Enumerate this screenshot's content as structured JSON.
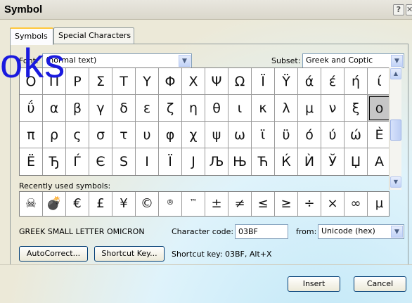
{
  "window": {
    "title": "Symbol"
  },
  "titlebar_buttons": {
    "help": "?",
    "close": "✕"
  },
  "tabs": [
    {
      "label": "Symbols",
      "active": true
    },
    {
      "label": "Special Characters",
      "active": false
    }
  ],
  "font": {
    "label": "Font:",
    "value": "(normal text)"
  },
  "subset": {
    "label": "Subset:",
    "value": "Greek and Coptic"
  },
  "symbols": [
    [
      "Ο",
      "Π",
      "Ρ",
      "Σ",
      "Τ",
      "Υ",
      "Φ",
      "Χ",
      "Ψ",
      "Ω",
      "Ϊ",
      "Ϋ",
      "ά",
      "έ",
      "ή",
      "ί"
    ],
    [
      "ΰ",
      "α",
      "β",
      "γ",
      "δ",
      "ε",
      "ζ",
      "η",
      "θ",
      "ι",
      "κ",
      "λ",
      "μ",
      "ν",
      "ξ",
      "ο"
    ],
    [
      "π",
      "ρ",
      "ς",
      "σ",
      "τ",
      "υ",
      "φ",
      "χ",
      "ψ",
      "ω",
      "ϊ",
      "ϋ",
      "ό",
      "ύ",
      "ώ",
      "Ѐ"
    ],
    [
      "Ё",
      "Ђ",
      "Ѓ",
      "Є",
      "Ѕ",
      "І",
      "Ї",
      "Ј",
      "Љ",
      "Њ",
      "Ћ",
      "Ќ",
      "Ѝ",
      "Ў",
      "Џ",
      "А"
    ]
  ],
  "recent": {
    "label": "Recently used symbols:",
    "items": [
      "☠",
      "💣",
      "€",
      "£",
      "¥",
      "©",
      "®",
      "™",
      "±",
      "≠",
      "≤",
      "≥",
      "÷",
      "×",
      "∞",
      "µ"
    ]
  },
  "char_name": "GREEK SMALL LETTER OMICRON",
  "char_code": {
    "label": "Character code:",
    "value": "03BF"
  },
  "from": {
    "label": "from:",
    "value": "Unicode (hex)"
  },
  "buttons": {
    "autocorrect": "AutoCorrect...",
    "shortcut": "Shortcut Key...",
    "insert": "Insert",
    "cancel": "Cancel"
  },
  "shortcut_text": "Shortcut key: 03BF, Alt+X",
  "watermark": "oks",
  "icons": {
    "help": "help-icon",
    "close": "close-icon",
    "scroll_up": "scroll-up-icon",
    "scroll_down": "scroll-down-icon",
    "dropdown": "chevron-down-icon"
  }
}
